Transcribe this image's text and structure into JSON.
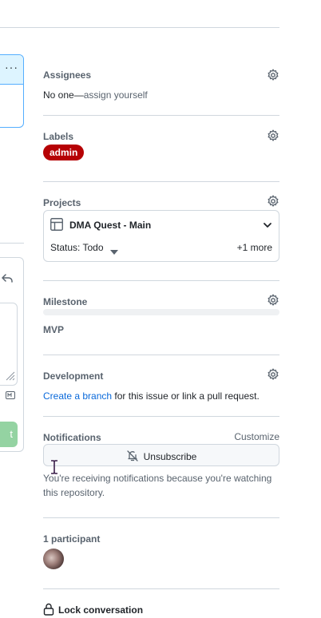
{
  "comment_editor": {
    "submit_label": "t"
  },
  "assignees": {
    "title": "Assignees",
    "none_text": "No one—",
    "assign_link": "assign yourself"
  },
  "labels": {
    "title": "Labels",
    "items": [
      {
        "name": "admin",
        "color": "#b60205"
      }
    ]
  },
  "projects": {
    "title": "Projects",
    "project_name": "DMA Quest - Main",
    "status": "Status: Todo",
    "more": "+1 more"
  },
  "milestone": {
    "title": "Milestone",
    "name": "MVP",
    "progress": 0
  },
  "development": {
    "title": "Development",
    "link_text": "Create a branch",
    "rest_text": " for this issue or link a pull request."
  },
  "notifications": {
    "title": "Notifications",
    "customize": "Customize",
    "button_label": "Unsubscribe",
    "reason_text": "You're receiving notifications because you're watching this repository."
  },
  "participants": {
    "title": "1 participant"
  },
  "lock": {
    "label": "Lock conversation"
  },
  "colors": {
    "accent_link": "#0969da",
    "label_admin": "#b60205",
    "selected_border": "#54aeff",
    "selected_bg": "#ddf4ff",
    "submit_disabled": "#94d3a2"
  }
}
